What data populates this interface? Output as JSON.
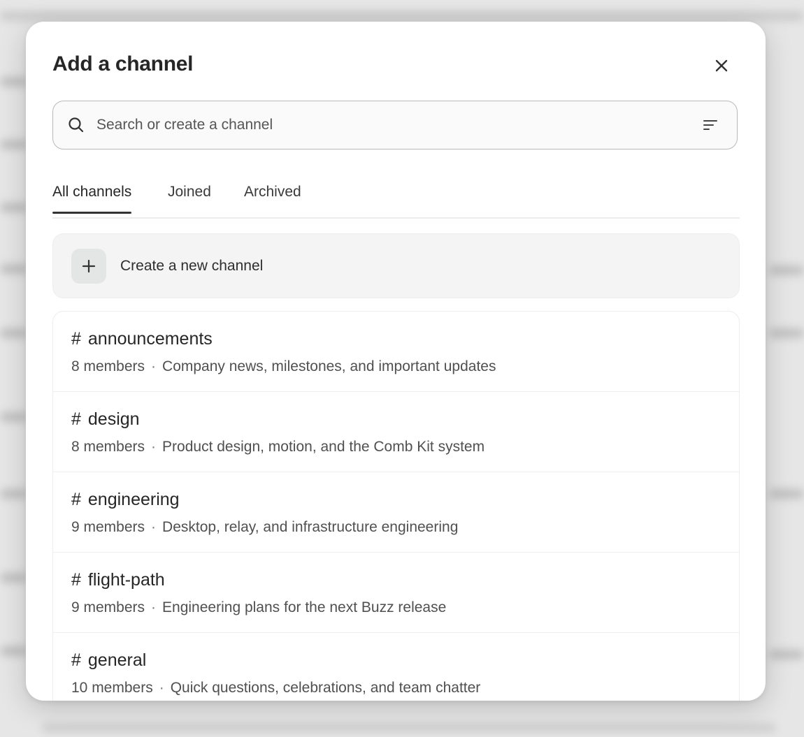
{
  "modal": {
    "title": "Add a channel",
    "close_icon": "close-icon"
  },
  "search": {
    "placeholder": "Search or create a channel",
    "value": "",
    "icon": "search-icon",
    "filter_icon": "filter-icon"
  },
  "tabs": [
    {
      "label": "All channels",
      "active": true
    },
    {
      "label": "Joined",
      "active": false
    },
    {
      "label": "Archived",
      "active": false
    }
  ],
  "create": {
    "icon": "plus-icon",
    "label": "Create a new channel"
  },
  "channels": [
    {
      "hash": "#",
      "name": "announcements",
      "members": "8 members",
      "separator": "·",
      "description": "Company news, milestones, and important updates"
    },
    {
      "hash": "#",
      "name": "design",
      "members": "8 members",
      "separator": "·",
      "description": "Product design, motion, and the Comb Kit system"
    },
    {
      "hash": "#",
      "name": "engineering",
      "members": "9 members",
      "separator": "·",
      "description": "Desktop, relay, and infrastructure engineering"
    },
    {
      "hash": "#",
      "name": "flight-path",
      "members": "9 members",
      "separator": "·",
      "description": "Engineering plans for the next Buzz release"
    },
    {
      "hash": "#",
      "name": "general",
      "members": "10 members",
      "separator": "·",
      "description": "Quick questions, celebrations, and team chatter"
    }
  ]
}
